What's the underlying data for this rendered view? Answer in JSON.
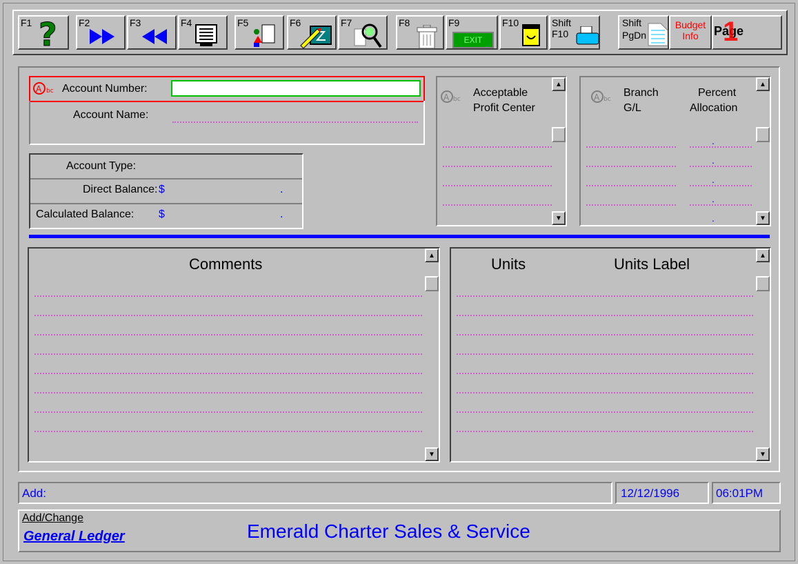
{
  "toolbar": {
    "buttons": [
      {
        "key": "F1"
      },
      {
        "key": "F2"
      },
      {
        "key": "F3"
      },
      {
        "key": "F4"
      },
      {
        "key": "F5"
      },
      {
        "key": "F6"
      },
      {
        "key": "F7"
      },
      {
        "key": "F8"
      },
      {
        "key": "F9"
      },
      {
        "key": "F10"
      },
      {
        "key": "Shift",
        "key2": "F10"
      },
      {
        "key": "Shift",
        "key2": "PgDn"
      }
    ],
    "exit_text": "EXIT",
    "budget_line1": "Budget",
    "budget_line2": "Info",
    "page_label": "Page",
    "page_number": "1"
  },
  "account": {
    "number_label": "Account Number:",
    "number_value": "",
    "name_label": "Account Name:",
    "type_label": "Account Type:",
    "direct_balance_label": "Direct Balance:",
    "calculated_balance_label": "Calculated Balance:",
    "currency": "$",
    "decimal": "."
  },
  "profit_center": {
    "header_line1": "Acceptable",
    "header_line2": "Profit Center"
  },
  "branch": {
    "col1_line1": "Branch",
    "col1_line2": "G/L",
    "col2_line1": "Percent",
    "col2_line2": "Allocation",
    "decimal": "."
  },
  "comments": {
    "header": "Comments"
  },
  "units": {
    "col1": "Units",
    "col2": "Units Label"
  },
  "status": {
    "mode": "Add:",
    "date": "12/12/1996",
    "time": "06:01PM"
  },
  "footer": {
    "link1": "Add/Change",
    "link2": "General Ledger",
    "company": "Emerald Charter Sales & Service"
  },
  "colors": {
    "accent": "#0000ff",
    "field_border": "#ff0000",
    "input_border": "#00c000",
    "dots": "#d05cd0"
  }
}
